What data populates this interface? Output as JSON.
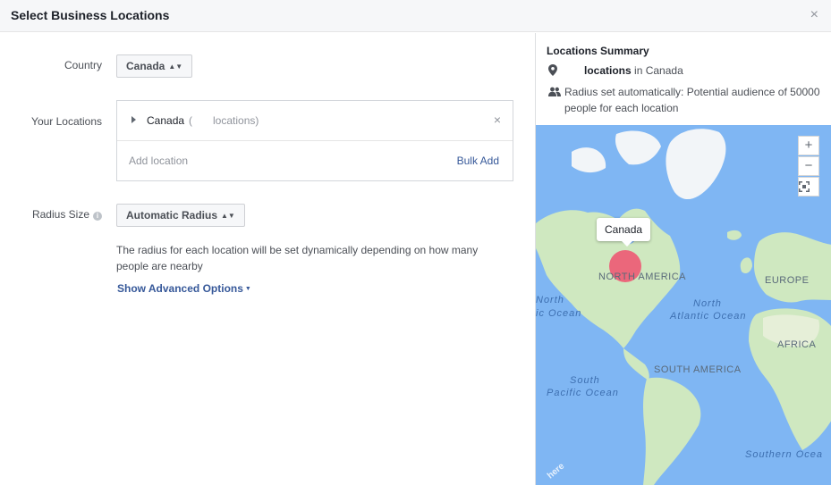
{
  "dialog": {
    "title": "Select Business Locations",
    "close_glyph": "×"
  },
  "form": {
    "country_label": "Country",
    "country_value": "Canada",
    "locations_label": "Your Locations",
    "location_entry": {
      "name": "Canada",
      "open_paren": "(",
      "count_text": "locations)"
    },
    "remove_glyph": "×",
    "add_location_placeholder": "Add location",
    "bulk_add_label": "Bulk Add",
    "radius_label": "Radius Size",
    "radius_value": "Automatic Radius",
    "radius_description": "The radius for each location will be set dynamically depending on how many people are nearby",
    "advanced_options_label": "Show Advanced Options"
  },
  "summary": {
    "title": "Locations Summary",
    "locations_word": "locations",
    "locations_suffix": "in Canada",
    "radius_text": "Radius set automatically: Potential audience of 50000 people for each location"
  },
  "map": {
    "zoom_in": "+",
    "zoom_out": "−",
    "tooltip": "Canada",
    "labels": {
      "north_america": "NORTH AMERICA",
      "europe": "EUROPE",
      "africa": "AFRICA",
      "south_america": "SOUTH AMERICA"
    },
    "oceans": {
      "north_atlantic_1": "North",
      "north_atlantic_2": "Atlantic Ocean",
      "north_pacific_1": "North",
      "north_pacific_2": "ic Ocean",
      "south_pacific_1": "South",
      "south_pacific_2": "Pacific Ocean",
      "southern": "Southern Ocea"
    },
    "attribution": "here",
    "colors": {
      "water": "#7fb6f3",
      "land": "#cfe8c0",
      "ice": "#f2f5f8",
      "marker": "#f0506e"
    }
  },
  "icons": {
    "close": "close-icon",
    "pin": "map-pin-icon",
    "people": "people-icon",
    "info": "info-icon",
    "fullscreen": "fullscreen-icon"
  }
}
